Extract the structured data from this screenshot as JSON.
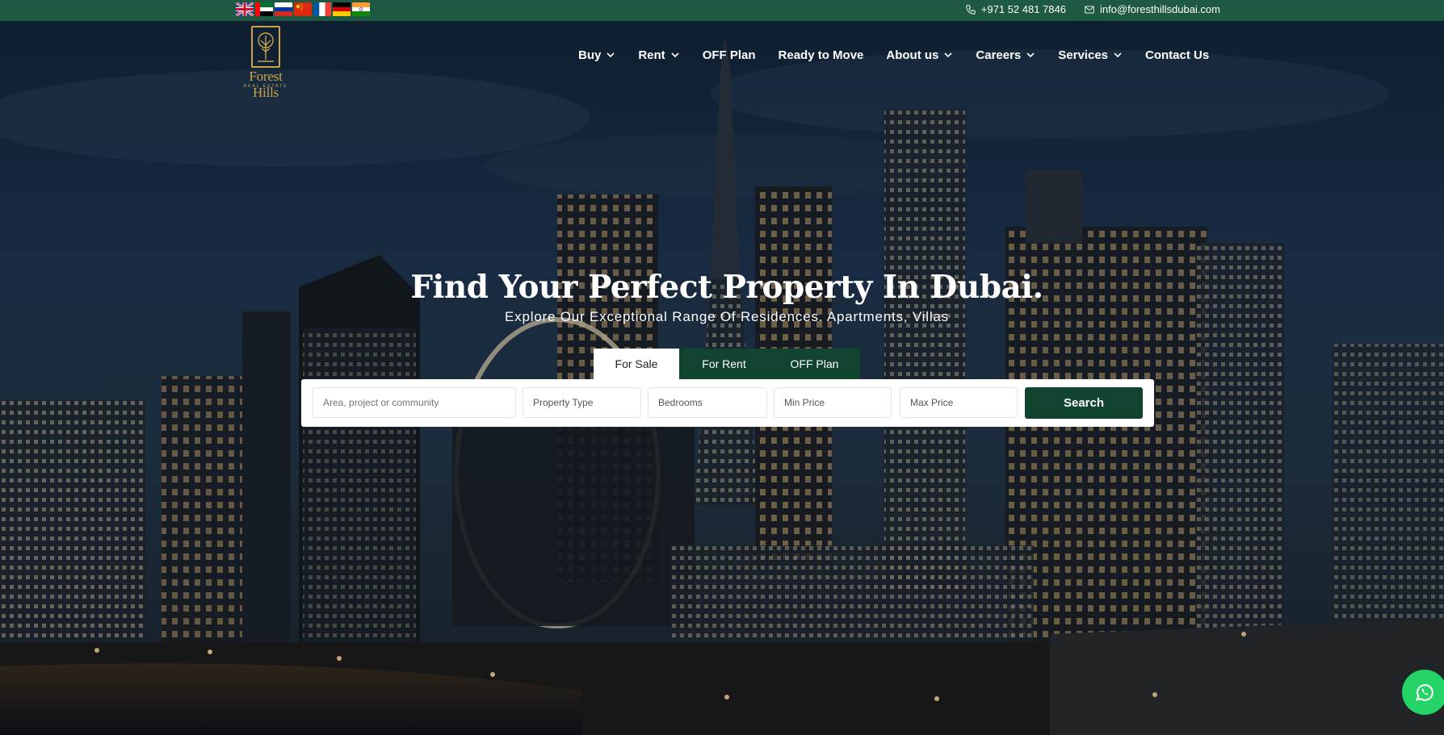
{
  "colors": {
    "brand_green": "#1e5a41",
    "dark_green": "#11442f",
    "gold": "#c9a64b",
    "whatsapp": "#25d366"
  },
  "topbar": {
    "flags": [
      "uk-flag-icon",
      "uae-flag-icon",
      "russia-flag-icon",
      "china-flag-icon",
      "france-flag-icon",
      "germany-flag-icon",
      "india-flag-icon"
    ],
    "phone": "+971 52 481 7846",
    "email": "info@foresthillsdubai.com"
  },
  "logo": {
    "name": "Forest Hills",
    "tagline": "REAL ESTATE"
  },
  "nav": {
    "items": [
      {
        "label": "Buy",
        "has_dropdown": true
      },
      {
        "label": "Rent",
        "has_dropdown": true
      },
      {
        "label": "OFF Plan",
        "has_dropdown": false
      },
      {
        "label": "Ready to Move",
        "has_dropdown": false
      },
      {
        "label": "About us",
        "has_dropdown": true
      },
      {
        "label": "Careers",
        "has_dropdown": true
      },
      {
        "label": "Services",
        "has_dropdown": true
      },
      {
        "label": "Contact Us",
        "has_dropdown": false
      }
    ]
  },
  "hero": {
    "title": "Find Your Perfect Property In Dubai.",
    "subtitle": "Explore Our Exceptional Range Of Residences. Apartments, Villas"
  },
  "search": {
    "tabs": [
      "For Sale",
      "For Rent",
      "OFF Plan"
    ],
    "active_tab": "For Sale",
    "area_placeholder": "Area, project or community",
    "property_type": "Property Type",
    "bedrooms": "Bedrooms",
    "min_price": "Min Price",
    "max_price": "Max Price",
    "button": "Search"
  }
}
